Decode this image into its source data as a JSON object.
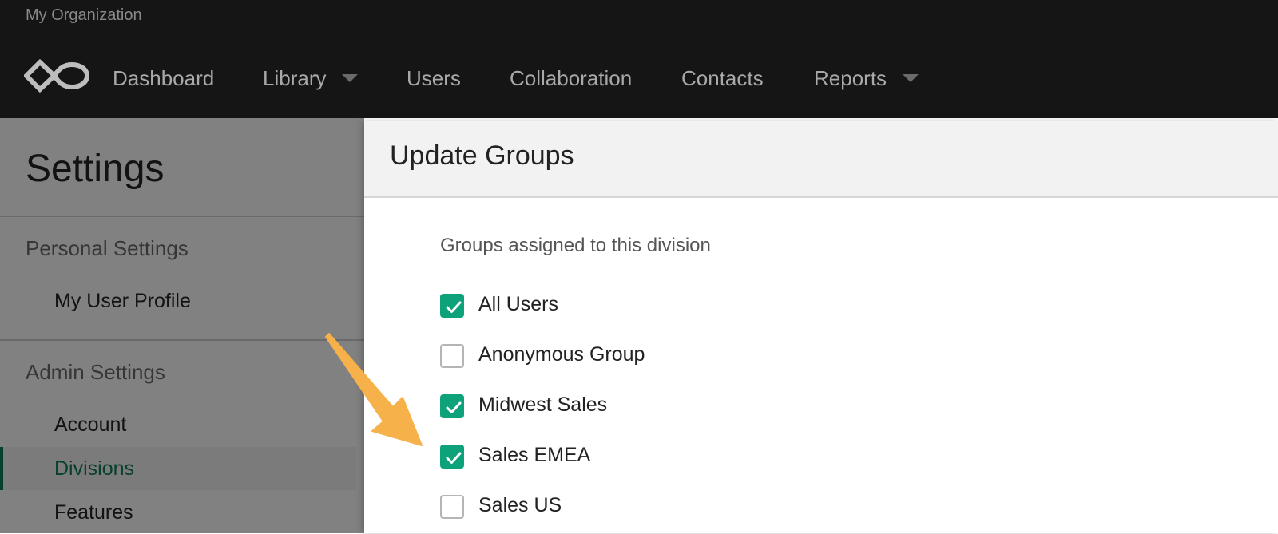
{
  "header": {
    "org_name": "My Organization",
    "nav": [
      {
        "label": "Dashboard",
        "has_dropdown": false
      },
      {
        "label": "Library",
        "has_dropdown": true
      },
      {
        "label": "Users",
        "has_dropdown": false
      },
      {
        "label": "Collaboration",
        "has_dropdown": false
      },
      {
        "label": "Contacts",
        "has_dropdown": false
      },
      {
        "label": "Reports",
        "has_dropdown": true
      }
    ],
    "logo_icon": "infinity-logo-icon"
  },
  "settings": {
    "title": "Settings",
    "personal_section": "Personal Settings",
    "personal_items": [
      "My User Profile"
    ],
    "admin_section": "Admin Settings",
    "admin_items": [
      "Account",
      "Divisions",
      "Features"
    ],
    "active_item": "Divisions"
  },
  "modal": {
    "title": "Update Groups",
    "subtitle": "Groups assigned to this division",
    "groups": [
      {
        "label": "All Users",
        "checked": true
      },
      {
        "label": "Anonymous Group",
        "checked": false
      },
      {
        "label": "Midwest Sales",
        "checked": true
      },
      {
        "label": "Sales EMEA",
        "checked": true
      },
      {
        "label": "Sales US",
        "checked": false
      }
    ]
  },
  "colors": {
    "header_bg": "#151515",
    "accent_green": "#0ea27a",
    "active_nav_green": "#0e7a54",
    "annotation_arrow": "#f7b14a"
  }
}
